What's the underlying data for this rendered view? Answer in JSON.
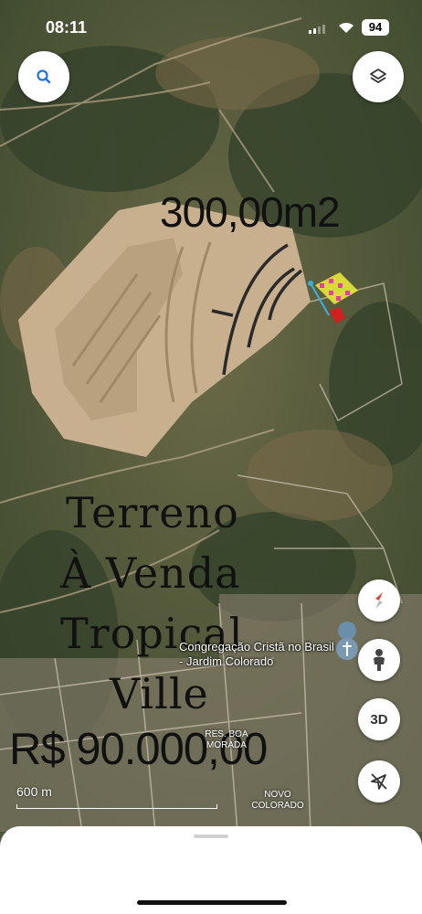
{
  "status_bar": {
    "time": "08:11",
    "battery": "94"
  },
  "map": {
    "scale_label": "600 m",
    "place_name": "Congregação Cristã no Brasil - Jardim Colorado",
    "street_label": "RES. BOA MORADA",
    "neighborhood_label": "NOVO COLORADO"
  },
  "overlay": {
    "area": "300,00m2",
    "title_lines": [
      "Terreno",
      "À Venda",
      "Tropical",
      "Ville"
    ],
    "price": "R$ 90.000,00"
  },
  "controls": {
    "search_icon": "search-icon",
    "layers_icon": "layers-icon",
    "compass_icon": "compass-icon",
    "street_view_icon": "pegman-icon",
    "mode_3d_label": "3D",
    "location_icon": "location-off-icon"
  },
  "colors": {
    "control_bg": "#ffffff",
    "compass_red": "#e04a3a",
    "search_blue": "#1a73e8"
  }
}
